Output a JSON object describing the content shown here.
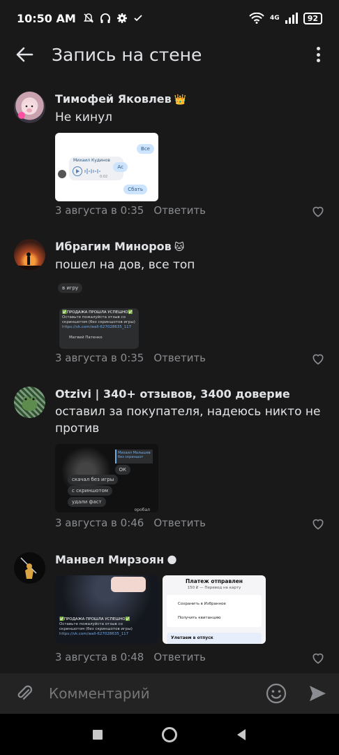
{
  "status": {
    "time": "10:50 AM",
    "network": "4G",
    "battery": "92"
  },
  "header": {
    "title": "Запись на стене"
  },
  "comments": [
    {
      "author": "Тимофей Яковлев",
      "badge": "👑",
      "text": "Не кинул",
      "time": "3 августа в 0:35",
      "reply": "Ответить",
      "shot": {
        "b1": "Все",
        "name": "Михаил Кудинов",
        "dur": "0:02",
        "b2": "Ас",
        "b3": "Сбать"
      }
    },
    {
      "author": "Ибрагим Миноров",
      "badge": "🐱",
      "text": "пошел на дов, все топ",
      "time": "3 августа в 0:35",
      "reply": "Ответить",
      "shot": {
        "l1": "в игру",
        "l2": "✅ПРОДАЖА ПРОШЛА УСПЕШНО✅",
        "l3": "Оставьте пожалуйста отзыв со скриншотом (без скриншотов игры)",
        "l4": "https://vk.com/wall-627028635_117",
        "l5": "Матвей Патенко"
      }
    },
    {
      "author": "Otzivi | 340+ отзывов, 3400 доверие",
      "badge": "",
      "text": "оставил за покупателя, надеюсь никто не против",
      "time": "3 августа в 0:46",
      "reply": "Ответить",
      "shot": {
        "m1": "Михаил Малышев без скриншот",
        "m2": "ОК",
        "m3": "скачал без игры",
        "m4": "с скриншотом",
        "m5": "удали фаст",
        "m6": "оробал"
      }
    },
    {
      "author": "Манвел Мирзоян",
      "badge": "🌑",
      "text": "",
      "time": "3 августа в 0:48",
      "reply": "Ответить",
      "shot": {
        "l2": "✅ПРОДАЖА ПРОШЛА УСПЕШНО✅",
        "l3": "Оставьте пожалуйста отзыв со скриншотом (без скриншотов игры)",
        "l4": "https://vk.com/wall-627028635_117"
      },
      "shot2": {
        "title": "Платеж отправлен",
        "sub": "150 ₽ — Перевод на карту",
        "row1": "Сохранить в Избранное",
        "row2": "Получить квитанцию",
        "promo": "Улетаем в отпуск"
      }
    }
  ],
  "composer": {
    "placeholder": "Комментарий"
  }
}
